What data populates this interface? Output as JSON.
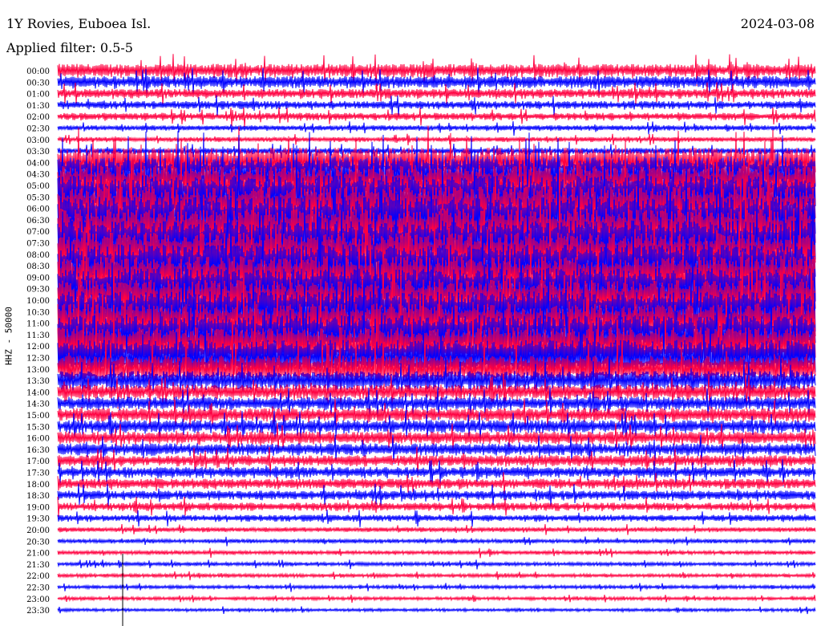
{
  "header": {
    "station": "1Y Rovies, Euboea Isl.",
    "filter": "Applied filter: 0.5-5",
    "date": "2024-03-08"
  },
  "y_axis_label": "HHZ - 50000",
  "colors": {
    "red": "#ff0040",
    "blue": "#0000ff",
    "background": "#ffffff",
    "text": "#000000"
  },
  "chart_data": {
    "type": "line",
    "title": "1Y Rovies, Euboea Isl.",
    "subtitle": "Applied filter: 0.5-5",
    "date": "2024-03-08",
    "ylabel": "HHZ - 50000",
    "row_labels": [
      "00:00",
      "00:30",
      "01:00",
      "01:30",
      "02:00",
      "02:30",
      "03:00",
      "03:30",
      "04:00",
      "04:30",
      "05:00",
      "05:30",
      "06:00",
      "06:30",
      "07:00",
      "07:30",
      "08:00",
      "08:30",
      "09:00",
      "09:30",
      "10:00",
      "10:30",
      "11:00",
      "11:30",
      "12:00",
      "12:30",
      "13:00",
      "13:30",
      "14:00",
      "14:30",
      "15:00",
      "15:30",
      "16:00",
      "16:30",
      "17:00",
      "17:30",
      "18:00",
      "18:30",
      "19:00",
      "19:30",
      "20:00",
      "20:30",
      "21:00",
      "21:30",
      "22:00",
      "22:30",
      "23:00",
      "23:30"
    ],
    "row_colors": [
      "red",
      "blue",
      "red",
      "blue",
      "red",
      "blue",
      "red",
      "blue",
      "red",
      "blue",
      "red",
      "blue",
      "red",
      "blue",
      "red",
      "blue",
      "red",
      "blue",
      "red",
      "blue",
      "red",
      "blue",
      "red",
      "blue",
      "red",
      "blue",
      "red",
      "blue",
      "red",
      "blue",
      "red",
      "blue",
      "red",
      "blue",
      "red",
      "blue",
      "red",
      "blue",
      "red",
      "blue",
      "red",
      "blue",
      "red",
      "blue",
      "red",
      "blue",
      "red",
      "blue"
    ],
    "relative_amplitude": [
      1.0,
      0.9,
      0.7,
      0.6,
      0.55,
      0.4,
      0.35,
      0.45,
      2.2,
      2.6,
      3.0,
      3.2,
      3.3,
      3.4,
      3.4,
      3.3,
      3.2,
      3.2,
      3.1,
      3.0,
      3.0,
      3.0,
      2.9,
      2.9,
      2.8,
      2.6,
      2.0,
      1.4,
      1.1,
      1.0,
      1.0,
      0.95,
      0.95,
      0.9,
      0.85,
      0.8,
      0.75,
      0.7,
      0.6,
      0.5,
      0.35,
      0.3,
      0.28,
      0.27,
      0.26,
      0.25,
      0.24,
      0.22
    ],
    "grid": false,
    "legend": "none"
  }
}
